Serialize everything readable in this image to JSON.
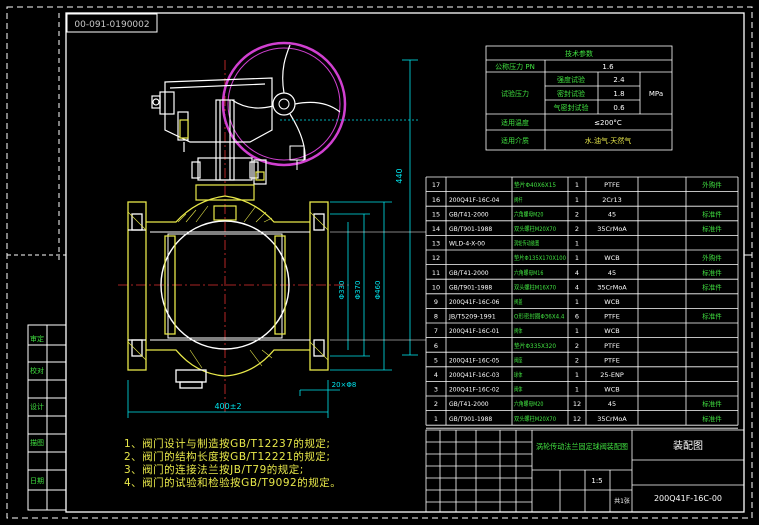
{
  "drawing_code_stamp": "00-091-0190002",
  "spec_table": {
    "title": "技术参数",
    "rows": [
      {
        "label": "公称压力 PN",
        "value": "1.6"
      },
      {
        "label": "试验压力",
        "sub": [
          {
            "name": "强度试验",
            "value": "2.4"
          },
          {
            "name": "密封试验",
            "value": "1.8"
          },
          {
            "name": "气密封试验",
            "value": "0.6"
          }
        ],
        "unit": "MPa"
      },
      {
        "label": "适用温度",
        "value": "≤200°C"
      },
      {
        "label": "适用介质",
        "value": "水.油气.天然气"
      }
    ]
  },
  "dimensions": {
    "height": "440",
    "overall_length": "400±2",
    "d1": "Φ460",
    "d2": "Φ370",
    "d3": "Φ330",
    "bolts": "20×Φ8"
  },
  "bom": [
    {
      "no": "17",
      "code": "",
      "name": "垫片Φ40X6X15",
      "qty": "1",
      "material": "PTFE",
      "note": "",
      "remark": "外购件"
    },
    {
      "no": "16",
      "code": "200Q41F-16C-04",
      "name": "阀杆",
      "qty": "1",
      "material": "2Cr13",
      "note": "",
      "remark": ""
    },
    {
      "no": "15",
      "code": "GB/T41-2000",
      "name": "六角螺母M20",
      "qty": "2",
      "material": "45",
      "note": "",
      "remark": "标准件"
    },
    {
      "no": "14",
      "code": "GB/T901-1988",
      "name": "双头螺柱M20X70",
      "qty": "2",
      "material": "35CrMoA",
      "note": "",
      "remark": "标准件"
    },
    {
      "no": "13",
      "code": "WLD-4-X-00",
      "name": "涡轮传动装置",
      "qty": "1",
      "material": "",
      "note": "",
      "remark": ""
    },
    {
      "no": "12",
      "code": "",
      "name": "垫片Φ135X170X100",
      "qty": "1",
      "material": "WCB",
      "note": "",
      "remark": "外购件"
    },
    {
      "no": "11",
      "code": "GB/T41-2000",
      "name": "六角螺母M16",
      "qty": "4",
      "material": "45",
      "note": "",
      "remark": "标准件"
    },
    {
      "no": "10",
      "code": "GB/T901-1988",
      "name": "双头螺柱M16X70",
      "qty": "4",
      "material": "35CrMoA",
      "note": "",
      "remark": "标准件"
    },
    {
      "no": "9",
      "code": "200Q41F-16C-06",
      "name": "阀盖",
      "qty": "1",
      "material": "WCB",
      "note": "",
      "remark": ""
    },
    {
      "no": "8",
      "code": "JB/T5209-1991",
      "name": "O形密封圈Φ36X4.4",
      "qty": "6",
      "material": "PTFE",
      "note": "",
      "remark": "标准件"
    },
    {
      "no": "7",
      "code": "200Q41F-16C-01",
      "name": "阀体",
      "qty": "1",
      "material": "WCB",
      "note": "",
      "remark": ""
    },
    {
      "no": "6",
      "code": "",
      "name": "垫片Φ335X320",
      "qty": "2",
      "material": "PTFE",
      "note": "",
      "remark": ""
    },
    {
      "no": "5",
      "code": "200Q41F-16C-05",
      "name": "阀座",
      "qty": "2",
      "material": "PTFE",
      "note": "",
      "remark": ""
    },
    {
      "no": "4",
      "code": "200Q41F-16C-03",
      "name": "球体",
      "qty": "1",
      "material": "25-ENP",
      "note": "",
      "remark": ""
    },
    {
      "no": "3",
      "code": "200Q41F-16C-02",
      "name": "阀体",
      "qty": "1",
      "material": "WCB",
      "note": "",
      "remark": ""
    },
    {
      "no": "2",
      "code": "GB/T41-2000",
      "name": "六角螺母M20",
      "qty": "12",
      "material": "45",
      "note": "",
      "remark": "标准件"
    },
    {
      "no": "1",
      "code": "GB/T901-1988",
      "name": "双头螺柱M20X70",
      "qty": "12",
      "material": "35CrMoA",
      "note": "",
      "remark": "标准件"
    }
  ],
  "title_block": {
    "product": "涡轮传动法兰固定球阀装配图",
    "drawing_name": "装配图",
    "drawing_no": "200Q41F-16C-00",
    "scale": "1:5",
    "sheet": "共1张"
  },
  "notes": [
    "1、阀门设计与制造按GB/T12237的规定;",
    "2、阀门的结构长度按GB/T12221的规定;",
    "3、阀门的连接法兰按JB/T79的规定;",
    "4、阀门的试验和检验按GB/T9092的规定。"
  ],
  "left_strip": [
    "审定",
    "校对",
    "设计",
    "描图",
    "日期"
  ],
  "colors": {
    "frame": "#ffffff",
    "cyan": "#00e5ee",
    "yellow": "#e8e84a",
    "magenta": "#d040d0",
    "green": "#40e040",
    "red": "#e03030"
  }
}
